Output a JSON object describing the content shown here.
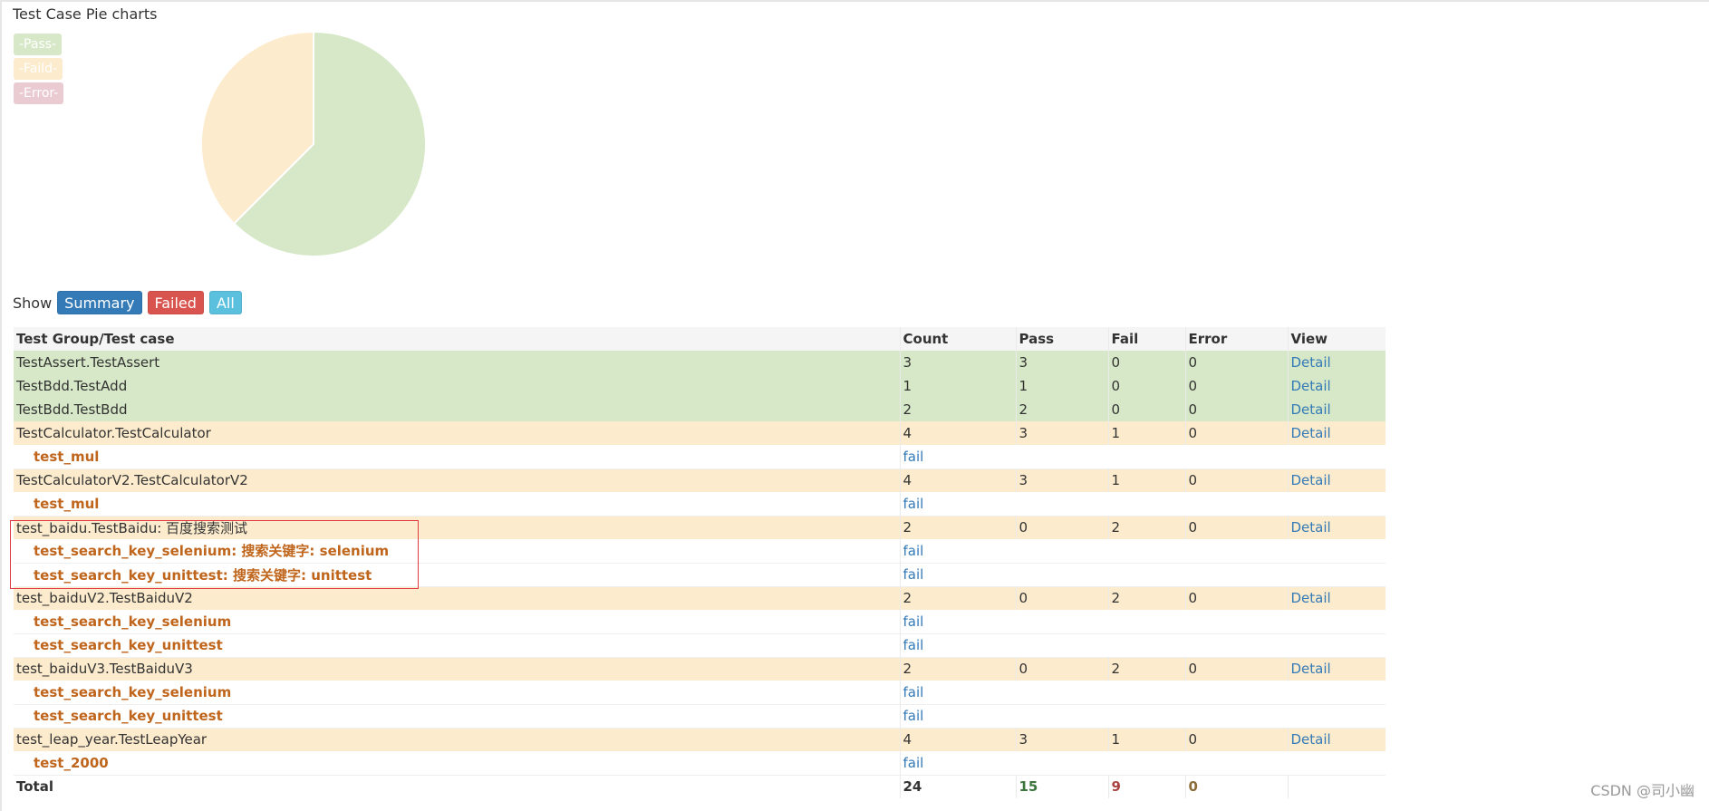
{
  "pie": {
    "title": "Test Case Pie charts",
    "legend": [
      {
        "label": "-Pass-",
        "color": "#d6e8c7"
      },
      {
        "label": "-Faild-",
        "color": "#fcebcc"
      },
      {
        "label": "-Error-",
        "color": "#eacbd2"
      }
    ]
  },
  "chart_data": {
    "type": "pie",
    "title": "Test Case Pie charts",
    "slices": [
      {
        "label": "-Pass-",
        "value": 15,
        "color": "#d6e8c7"
      },
      {
        "label": "-Faild-",
        "value": 9,
        "color": "#fcebcc"
      },
      {
        "label": "-Error-",
        "value": 0,
        "color": "#eacbd2"
      }
    ]
  },
  "show": {
    "label": "Show",
    "summary": "Summary",
    "failed": "Failed",
    "all": "All"
  },
  "table": {
    "headers": [
      "Test Group/Test case",
      "Count",
      "Pass",
      "Fail",
      "Error",
      "View"
    ],
    "rows": [
      {
        "kind": "group",
        "status": "pass",
        "name": "TestAssert.TestAssert",
        "count": "3",
        "pass": "3",
        "fail": "0",
        "error": "0",
        "view": "Detail"
      },
      {
        "kind": "group",
        "status": "pass",
        "name": "TestBdd.TestAdd",
        "count": "1",
        "pass": "1",
        "fail": "0",
        "error": "0",
        "view": "Detail"
      },
      {
        "kind": "group",
        "status": "pass",
        "name": "TestBdd.TestBdd",
        "count": "2",
        "pass": "2",
        "fail": "0",
        "error": "0",
        "view": "Detail"
      },
      {
        "kind": "group",
        "status": "fail",
        "name": "TestCalculator.TestCalculator",
        "count": "4",
        "pass": "3",
        "fail": "1",
        "error": "0",
        "view": "Detail"
      },
      {
        "kind": "case",
        "name": "test_mul",
        "result": "fail"
      },
      {
        "kind": "group",
        "status": "fail",
        "name": "TestCalculatorV2.TestCalculatorV2",
        "count": "4",
        "pass": "3",
        "fail": "1",
        "error": "0",
        "view": "Detail"
      },
      {
        "kind": "case",
        "name": "test_mul",
        "result": "fail"
      },
      {
        "kind": "group",
        "status": "fail",
        "name": "test_baidu.TestBaidu: 百度搜索测试",
        "count": "2",
        "pass": "0",
        "fail": "2",
        "error": "0",
        "view": "Detail"
      },
      {
        "kind": "case",
        "name": "test_search_key_selenium: 搜索关键字: selenium",
        "result": "fail"
      },
      {
        "kind": "case",
        "name": "test_search_key_unittest: 搜索关键字: unittest",
        "result": "fail"
      },
      {
        "kind": "group",
        "status": "fail",
        "name": "test_baiduV2.TestBaiduV2",
        "count": "2",
        "pass": "0",
        "fail": "2",
        "error": "0",
        "view": "Detail"
      },
      {
        "kind": "case",
        "name": "test_search_key_selenium",
        "result": "fail"
      },
      {
        "kind": "case",
        "name": "test_search_key_unittest",
        "result": "fail"
      },
      {
        "kind": "group",
        "status": "fail",
        "name": "test_baiduV3.TestBaiduV3",
        "count": "2",
        "pass": "0",
        "fail": "2",
        "error": "0",
        "view": "Detail"
      },
      {
        "kind": "case",
        "name": "test_search_key_selenium",
        "result": "fail"
      },
      {
        "kind": "case",
        "name": "test_search_key_unittest",
        "result": "fail"
      },
      {
        "kind": "group",
        "status": "fail",
        "name": "test_leap_year.TestLeapYear",
        "count": "4",
        "pass": "3",
        "fail": "1",
        "error": "0",
        "view": "Detail"
      },
      {
        "kind": "case",
        "name": "test_2000",
        "result": "fail"
      }
    ],
    "total": {
      "name": "Total",
      "count": "24",
      "pass": "15",
      "fail": "9",
      "error": "0"
    }
  },
  "watermark": "CSDN @司小幽"
}
